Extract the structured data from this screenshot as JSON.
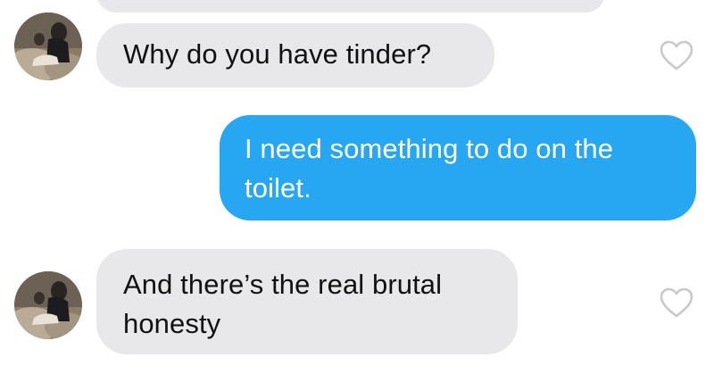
{
  "conversation": {
    "messages": [
      {
        "sender": "match",
        "text": "Why do you have tinder?",
        "liked": false
      },
      {
        "sender": "me",
        "text": "I need something to do on the toilet.",
        "liked": false
      },
      {
        "sender": "match",
        "text": "And there’s the real brutal honesty",
        "liked": false
      }
    ]
  },
  "colors": {
    "incoming_bubble": "#e8e8ea",
    "outgoing_bubble": "#27a6f1",
    "heart_outline": "#c9c9cc"
  },
  "icons": {
    "like": "heart-outline-icon",
    "avatar": "profile-photo"
  }
}
